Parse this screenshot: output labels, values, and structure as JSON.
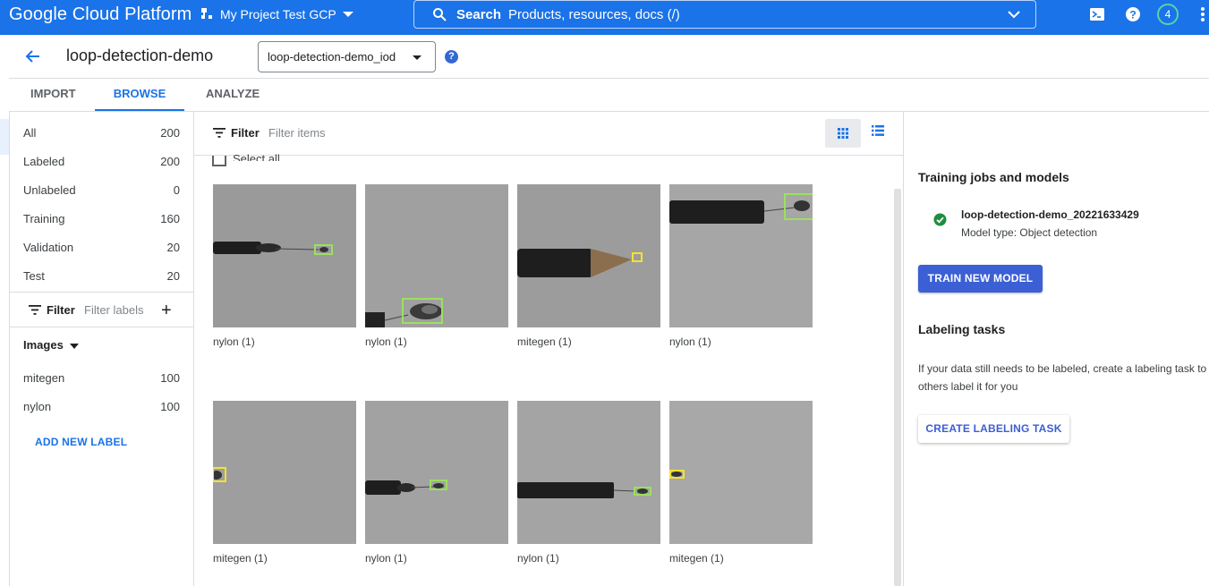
{
  "topbar": {
    "brand": "Google Cloud Platform",
    "project": "My Project Test GCP",
    "search_label": "Search",
    "search_placeholder": "Products, resources, docs (/)",
    "avatar_badge": "4"
  },
  "header": {
    "title": "loop-detection-demo",
    "dataset_select": "loop-detection-demo_iod",
    "help": "?"
  },
  "tabs": [
    {
      "label": "IMPORT"
    },
    {
      "label": "BROWSE",
      "active": true
    },
    {
      "label": "ANALYZE"
    }
  ],
  "categories": [
    {
      "label": "All",
      "count": "200"
    },
    {
      "label": "Labeled",
      "count": "200"
    },
    {
      "label": "Unlabeled",
      "count": "0"
    },
    {
      "label": "Training",
      "count": "160"
    },
    {
      "label": "Validation",
      "count": "20"
    },
    {
      "label": "Test",
      "count": "20"
    }
  ],
  "label_filter": {
    "label": "Filter",
    "placeholder": "Filter labels"
  },
  "images_section": {
    "heading": "Images",
    "labels": [
      {
        "label": "mitegen",
        "count": "100"
      },
      {
        "label": "nylon",
        "count": "100"
      }
    ],
    "add_label": "ADD NEW LABEL"
  },
  "item_filter": {
    "label": "Filter",
    "placeholder": "Filter items"
  },
  "select_all": "Select all",
  "images": [
    {
      "caption": "nylon (1)"
    },
    {
      "caption": "nylon (1)"
    },
    {
      "caption": "mitegen (1)"
    },
    {
      "caption": "nylon (1)"
    },
    {
      "caption": "mitegen (1)"
    },
    {
      "caption": "nylon (1)"
    },
    {
      "caption": "nylon (1)"
    },
    {
      "caption": "mitegen (1)"
    }
  ],
  "right_panel": {
    "training_heading": "Training jobs and models",
    "model_name": "loop-detection-demo_20221633429",
    "model_type": "Model type: Object detection",
    "train_button": "TRAIN NEW MODEL",
    "labeling_heading": "Labeling tasks",
    "labeling_desc_1": "If your data still needs to be labeled, create a labeling task to have",
    "labeling_desc_2": "others label it for you",
    "create_button": "CREATE LABELING TASK"
  },
  "colors": {
    "brand_blue": "#1a73e8",
    "bbox_green": "#9be060",
    "bbox_yellow": "#f5e22f",
    "success_green": "#1e8e3e"
  }
}
